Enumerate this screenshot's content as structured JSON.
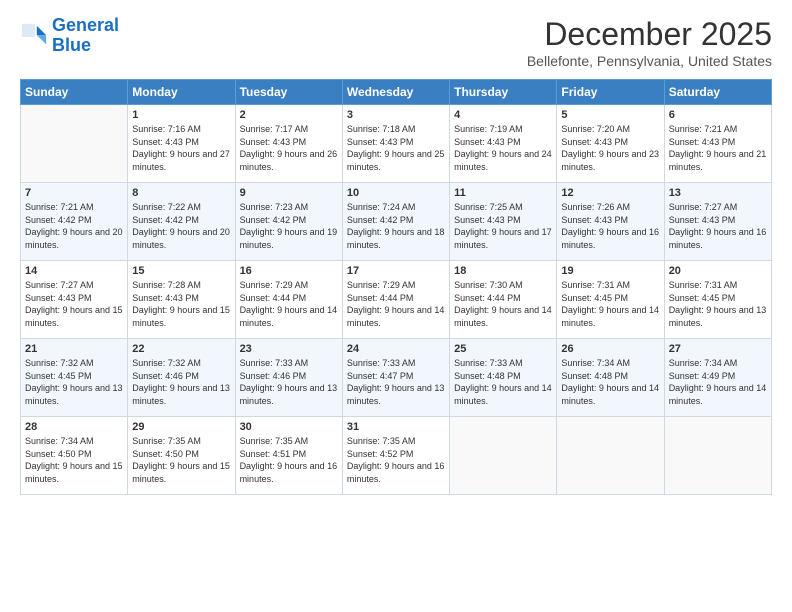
{
  "header": {
    "logo_line1": "General",
    "logo_line2": "Blue",
    "month_title": "December 2025",
    "subtitle": "Bellefonte, Pennsylvania, United States"
  },
  "days_header": [
    "Sunday",
    "Monday",
    "Tuesday",
    "Wednesday",
    "Thursday",
    "Friday",
    "Saturday"
  ],
  "weeks": [
    [
      {
        "day": "",
        "sunrise": "",
        "sunset": "",
        "daylight": ""
      },
      {
        "day": "1",
        "sunrise": "Sunrise: 7:16 AM",
        "sunset": "Sunset: 4:43 PM",
        "daylight": "Daylight: 9 hours and 27 minutes."
      },
      {
        "day": "2",
        "sunrise": "Sunrise: 7:17 AM",
        "sunset": "Sunset: 4:43 PM",
        "daylight": "Daylight: 9 hours and 26 minutes."
      },
      {
        "day": "3",
        "sunrise": "Sunrise: 7:18 AM",
        "sunset": "Sunset: 4:43 PM",
        "daylight": "Daylight: 9 hours and 25 minutes."
      },
      {
        "day": "4",
        "sunrise": "Sunrise: 7:19 AM",
        "sunset": "Sunset: 4:43 PM",
        "daylight": "Daylight: 9 hours and 24 minutes."
      },
      {
        "day": "5",
        "sunrise": "Sunrise: 7:20 AM",
        "sunset": "Sunset: 4:43 PM",
        "daylight": "Daylight: 9 hours and 23 minutes."
      },
      {
        "day": "6",
        "sunrise": "Sunrise: 7:21 AM",
        "sunset": "Sunset: 4:43 PM",
        "daylight": "Daylight: 9 hours and 21 minutes."
      }
    ],
    [
      {
        "day": "7",
        "sunrise": "Sunrise: 7:21 AM",
        "sunset": "Sunset: 4:42 PM",
        "daylight": "Daylight: 9 hours and 20 minutes."
      },
      {
        "day": "8",
        "sunrise": "Sunrise: 7:22 AM",
        "sunset": "Sunset: 4:42 PM",
        "daylight": "Daylight: 9 hours and 20 minutes."
      },
      {
        "day": "9",
        "sunrise": "Sunrise: 7:23 AM",
        "sunset": "Sunset: 4:42 PM",
        "daylight": "Daylight: 9 hours and 19 minutes."
      },
      {
        "day": "10",
        "sunrise": "Sunrise: 7:24 AM",
        "sunset": "Sunset: 4:42 PM",
        "daylight": "Daylight: 9 hours and 18 minutes."
      },
      {
        "day": "11",
        "sunrise": "Sunrise: 7:25 AM",
        "sunset": "Sunset: 4:43 PM",
        "daylight": "Daylight: 9 hours and 17 minutes."
      },
      {
        "day": "12",
        "sunrise": "Sunrise: 7:26 AM",
        "sunset": "Sunset: 4:43 PM",
        "daylight": "Daylight: 9 hours and 16 minutes."
      },
      {
        "day": "13",
        "sunrise": "Sunrise: 7:27 AM",
        "sunset": "Sunset: 4:43 PM",
        "daylight": "Daylight: 9 hours and 16 minutes."
      }
    ],
    [
      {
        "day": "14",
        "sunrise": "Sunrise: 7:27 AM",
        "sunset": "Sunset: 4:43 PM",
        "daylight": "Daylight: 9 hours and 15 minutes."
      },
      {
        "day": "15",
        "sunrise": "Sunrise: 7:28 AM",
        "sunset": "Sunset: 4:43 PM",
        "daylight": "Daylight: 9 hours and 15 minutes."
      },
      {
        "day": "16",
        "sunrise": "Sunrise: 7:29 AM",
        "sunset": "Sunset: 4:44 PM",
        "daylight": "Daylight: 9 hours and 14 minutes."
      },
      {
        "day": "17",
        "sunrise": "Sunrise: 7:29 AM",
        "sunset": "Sunset: 4:44 PM",
        "daylight": "Daylight: 9 hours and 14 minutes."
      },
      {
        "day": "18",
        "sunrise": "Sunrise: 7:30 AM",
        "sunset": "Sunset: 4:44 PM",
        "daylight": "Daylight: 9 hours and 14 minutes."
      },
      {
        "day": "19",
        "sunrise": "Sunrise: 7:31 AM",
        "sunset": "Sunset: 4:45 PM",
        "daylight": "Daylight: 9 hours and 14 minutes."
      },
      {
        "day": "20",
        "sunrise": "Sunrise: 7:31 AM",
        "sunset": "Sunset: 4:45 PM",
        "daylight": "Daylight: 9 hours and 13 minutes."
      }
    ],
    [
      {
        "day": "21",
        "sunrise": "Sunrise: 7:32 AM",
        "sunset": "Sunset: 4:45 PM",
        "daylight": "Daylight: 9 hours and 13 minutes."
      },
      {
        "day": "22",
        "sunrise": "Sunrise: 7:32 AM",
        "sunset": "Sunset: 4:46 PM",
        "daylight": "Daylight: 9 hours and 13 minutes."
      },
      {
        "day": "23",
        "sunrise": "Sunrise: 7:33 AM",
        "sunset": "Sunset: 4:46 PM",
        "daylight": "Daylight: 9 hours and 13 minutes."
      },
      {
        "day": "24",
        "sunrise": "Sunrise: 7:33 AM",
        "sunset": "Sunset: 4:47 PM",
        "daylight": "Daylight: 9 hours and 13 minutes."
      },
      {
        "day": "25",
        "sunrise": "Sunrise: 7:33 AM",
        "sunset": "Sunset: 4:48 PM",
        "daylight": "Daylight: 9 hours and 14 minutes."
      },
      {
        "day": "26",
        "sunrise": "Sunrise: 7:34 AM",
        "sunset": "Sunset: 4:48 PM",
        "daylight": "Daylight: 9 hours and 14 minutes."
      },
      {
        "day": "27",
        "sunrise": "Sunrise: 7:34 AM",
        "sunset": "Sunset: 4:49 PM",
        "daylight": "Daylight: 9 hours and 14 minutes."
      }
    ],
    [
      {
        "day": "28",
        "sunrise": "Sunrise: 7:34 AM",
        "sunset": "Sunset: 4:50 PM",
        "daylight": "Daylight: 9 hours and 15 minutes."
      },
      {
        "day": "29",
        "sunrise": "Sunrise: 7:35 AM",
        "sunset": "Sunset: 4:50 PM",
        "daylight": "Daylight: 9 hours and 15 minutes."
      },
      {
        "day": "30",
        "sunrise": "Sunrise: 7:35 AM",
        "sunset": "Sunset: 4:51 PM",
        "daylight": "Daylight: 9 hours and 16 minutes."
      },
      {
        "day": "31",
        "sunrise": "Sunrise: 7:35 AM",
        "sunset": "Sunset: 4:52 PM",
        "daylight": "Daylight: 9 hours and 16 minutes."
      },
      {
        "day": "",
        "sunrise": "",
        "sunset": "",
        "daylight": ""
      },
      {
        "day": "",
        "sunrise": "",
        "sunset": "",
        "daylight": ""
      },
      {
        "day": "",
        "sunrise": "",
        "sunset": "",
        "daylight": ""
      }
    ]
  ]
}
